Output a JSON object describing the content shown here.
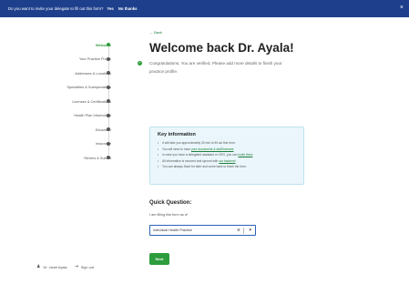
{
  "banner": {
    "text": "Do you want to invite your delegate to fill out this form?",
    "yes_label": "Yes",
    "no_label": "No thanks",
    "close_glyph": "×"
  },
  "sidebar": {
    "steps": [
      {
        "label": "Welcome",
        "active": true
      },
      {
        "label": "Your Practice Profile",
        "active": false
      },
      {
        "label": "Addresses & Locations",
        "active": false
      },
      {
        "label": "Specialties & Subspecialties",
        "active": false
      },
      {
        "label": "Licenses & Certifications",
        "active": false
      },
      {
        "label": "Health Plan Information",
        "active": false
      },
      {
        "label": "Education",
        "active": false
      },
      {
        "label": "Insurance",
        "active": false
      },
      {
        "label": "Review & Submit",
        "active": false
      }
    ],
    "footer": {
      "account_label": "Dr. Janet Ayala",
      "signout_label": "Sign out"
    }
  },
  "main": {
    "back_label": "← Back",
    "title": "Welcome back Dr. Ayala!",
    "congrats_text": "Congratulations. You are verified. Please add more details to finish your practice profile.",
    "info": {
      "title": "Key information",
      "items": [
        {
          "text": "It will take you approximately 30 min to fill out this form.",
          "link": ""
        },
        {
          "text": "You will need to have ",
          "link": "your documents & staff licenses"
        },
        {
          "text": "In case you have a delegated assistant or CRO, you can ",
          "link": "invite them"
        },
        {
          "text": "All information is secured and synced with ",
          "link": "our backend"
        },
        {
          "text": "You can always Save for later and come back to finish the form.",
          "link": ""
        }
      ]
    },
    "quick_question": "Quick Question:",
    "field_label": "I am filling this form as a*",
    "select_value": "Individual Health Practice",
    "next_label": "Next"
  },
  "colors": {
    "banner": "#1d3f8c",
    "accent_green": "#2e9d3d",
    "info_bg": "#eaf6fb",
    "select_border": "#2a62b8"
  },
  "icons": {
    "check": "check-circle-icon",
    "close": "close-icon",
    "clear": "clear-x-icon",
    "chevron": "chevron-down-icon",
    "user": "user-icon",
    "signout": "signout-icon"
  }
}
